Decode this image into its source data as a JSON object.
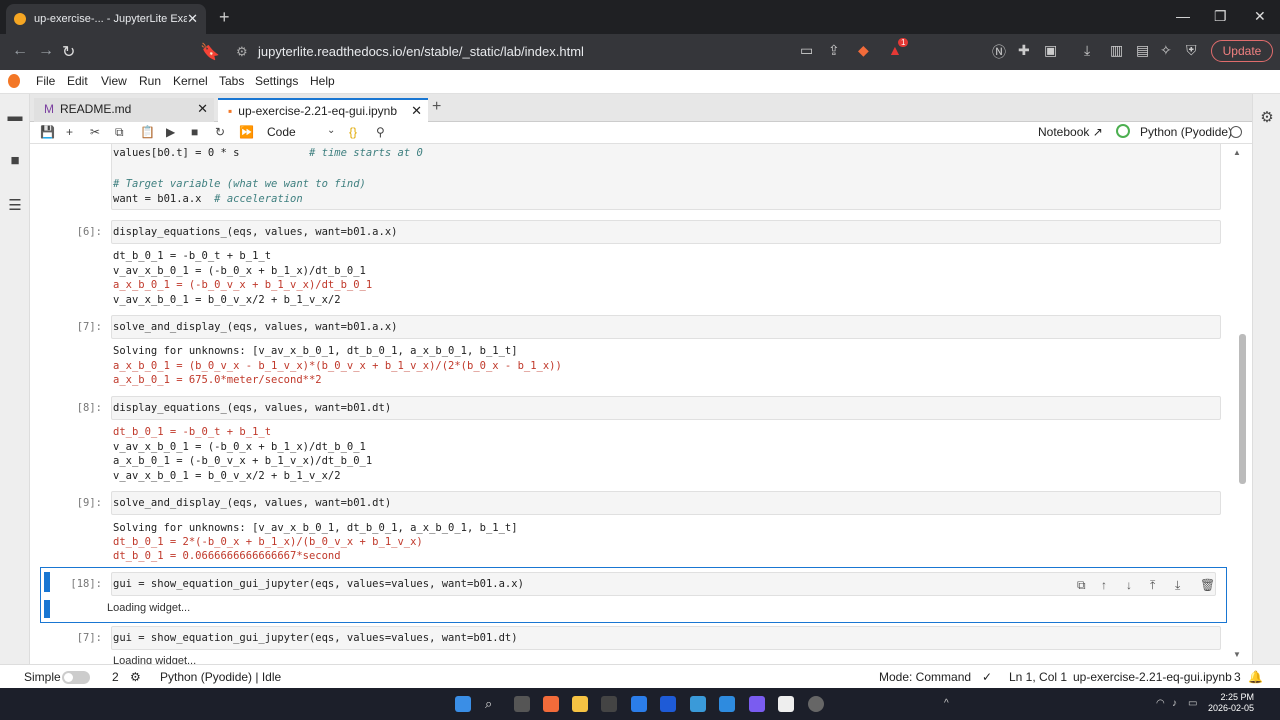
{
  "browser": {
    "tab_title": "up-exercise-... - JupyterLite Examples",
    "url": "jupyterlite.readthedocs.io/en/stable/_static/lab/index.html",
    "update_label": "Update",
    "brave_badge": "1"
  },
  "menu": [
    "File",
    "Edit",
    "View",
    "Run",
    "Kernel",
    "Tabs",
    "Settings",
    "Help"
  ],
  "doc_tabs": {
    "readme": "README.md",
    "notebook": "up-exercise-2.21-eq-gui.ipynb"
  },
  "toolbar": {
    "cell_type": "Code",
    "notebook_label": "Notebook",
    "kernel": "Python (Pyodide)"
  },
  "cells": {
    "top_lines": [
      "values[b0.t] = 0 * s",
      "# time starts at 0",
      "# Target variable (what we want to find)",
      "want = b01.a.x",
      "# acceleration"
    ],
    "c6_prompt": "[6]:",
    "c6_code": "display_equations_(eqs, values, want=b01.a.x)",
    "c6_out": [
      "dt_b_0_1 = -b_0_t + b_1_t",
      "v_av_x_b_0_1 = (-b_0_x + b_1_x)/dt_b_0_1",
      "a_x_b_0_1 = (-b_0_v_x + b_1_v_x)/dt_b_0_1",
      "v_av_x_b_0_1 = b_0_v_x/2 + b_1_v_x/2"
    ],
    "c7_prompt": "[7]:",
    "c7_code": "solve_and_display_(eqs, values, want=b01.a.x)",
    "c7_out": [
      "Solving for unknowns: [v_av_x_b_0_1, dt_b_0_1, a_x_b_0_1, b_1_t]",
      "a_x_b_0_1 = (b_0_v_x - b_1_v_x)*(b_0_v_x + b_1_v_x)/(2*(b_0_x - b_1_x))",
      "a_x_b_0_1 = 675.0*meter/second**2"
    ],
    "c8_prompt": "[8]:",
    "c8_code": "display_equations_(eqs, values, want=b01.dt)",
    "c8_out": [
      "dt_b_0_1 = -b_0_t + b_1_t",
      "v_av_x_b_0_1 = (-b_0_x + b_1_x)/dt_b_0_1",
      "a_x_b_0_1 = (-b_0_v_x + b_1_v_x)/dt_b_0_1",
      "v_av_x_b_0_1 = b_0_v_x/2 + b_1_v_x/2"
    ],
    "c9_prompt": "[9]:",
    "c9_code": "solve_and_display_(eqs, values, want=b01.dt)",
    "c9_out": [
      "Solving for unknowns: [v_av_x_b_0_1, dt_b_0_1, a_x_b_0_1, b_1_t]",
      "dt_b_0_1 = 2*(-b_0_x + b_1_x)/(b_0_v_x + b_1_v_x)",
      "dt_b_0_1 = 0.0666666666666667*second"
    ],
    "c18_prompt": "[18]:",
    "c18_code": "gui = show_equation_gui_jupyter(eqs, values=values, want=b01.a.x)",
    "c18_out": "Loading widget...",
    "c7b_prompt": "[7]:",
    "c7b_code": "gui = show_equation_gui_jupyter(eqs, values=values, want=b01.dt)",
    "c7b_out": "Loading widget..."
  },
  "status": {
    "mode_label": "Simple",
    "count": "2",
    "kernel_status": "Python (Pyodide) | Idle",
    "mode": "Mode: Command",
    "position": "Ln 1, Col 1",
    "filename": "up-exercise-2.21-eq-gui.ipynb",
    "notifications": "3"
  },
  "taskbar": {
    "time": "2:25 PM",
    "date": "2026-02-05"
  }
}
